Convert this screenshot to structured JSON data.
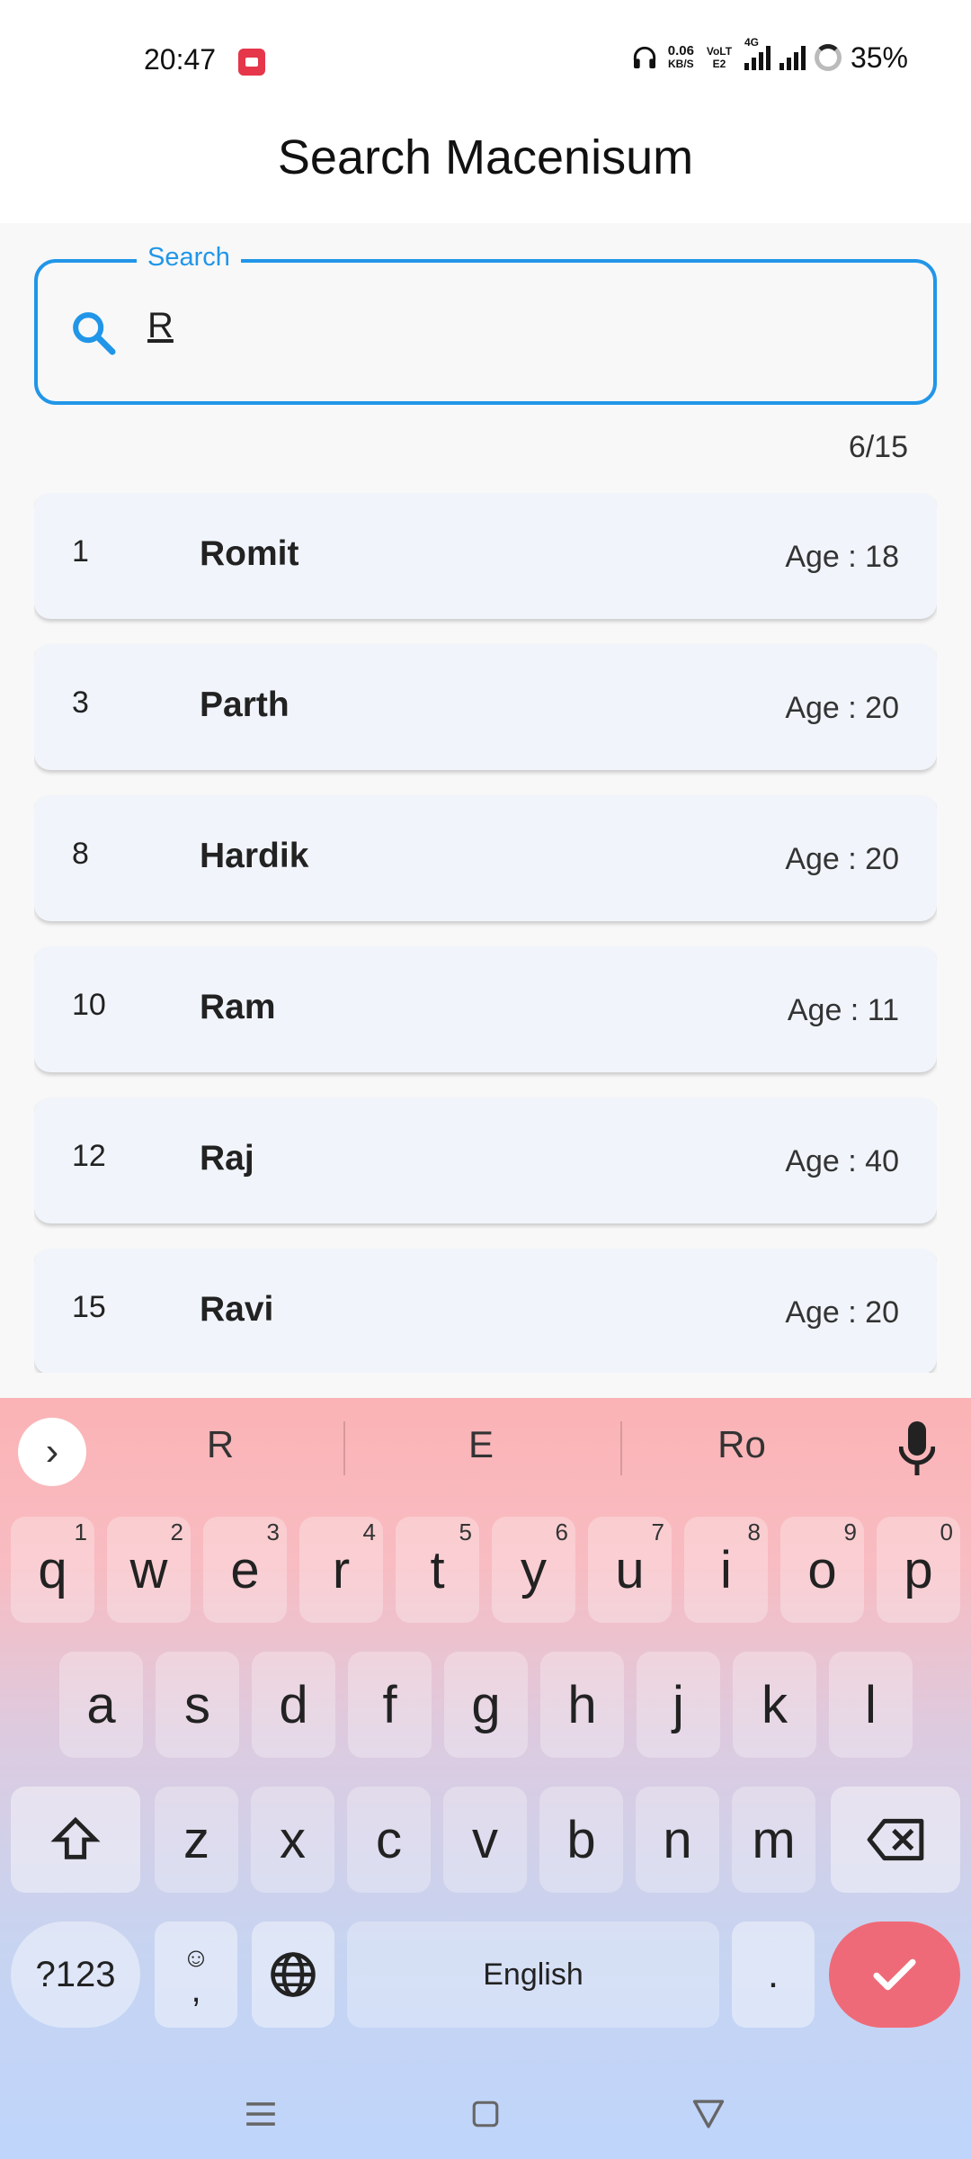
{
  "status": {
    "time": "20:47",
    "net_speed": "0.06",
    "net_unit": "KB/S",
    "volte": "VoLTE2",
    "network": "4G",
    "battery": "35%"
  },
  "appbar": {
    "title": "Search Macenisum"
  },
  "search": {
    "label": "Search",
    "value": "R"
  },
  "results": {
    "count": "6/15",
    "items": [
      {
        "id": "1",
        "name": "Romit",
        "age": "Age : 18"
      },
      {
        "id": "3",
        "name": "Parth",
        "age": "Age : 20"
      },
      {
        "id": "8",
        "name": "Hardik",
        "age": "Age : 20"
      },
      {
        "id": "10",
        "name": "Ram",
        "age": "Age : 11"
      },
      {
        "id": "12",
        "name": "Raj",
        "age": "Age : 40"
      },
      {
        "id": "15",
        "name": "Ravi",
        "age": "Age : 20"
      }
    ]
  },
  "keyboard": {
    "suggestions": [
      "R",
      "E",
      "Ro"
    ],
    "row1": [
      {
        "k": "q",
        "h": "1"
      },
      {
        "k": "w",
        "h": "2"
      },
      {
        "k": "e",
        "h": "3"
      },
      {
        "k": "r",
        "h": "4"
      },
      {
        "k": "t",
        "h": "5"
      },
      {
        "k": "y",
        "h": "6"
      },
      {
        "k": "u",
        "h": "7"
      },
      {
        "k": "i",
        "h": "8"
      },
      {
        "k": "o",
        "h": "9"
      },
      {
        "k": "p",
        "h": "0"
      }
    ],
    "row2": [
      "a",
      "s",
      "d",
      "f",
      "g",
      "h",
      "j",
      "k",
      "l"
    ],
    "row3": [
      "z",
      "x",
      "c",
      "v",
      "b",
      "n",
      "m"
    ],
    "symbols_label": "?123",
    "emoji_label": "☺",
    "comma_label": ",",
    "space_label": "English",
    "period_label": "."
  },
  "colors": {
    "accent": "#2196e8",
    "enter": "#ef6a78",
    "card": "#f1f5fb"
  }
}
